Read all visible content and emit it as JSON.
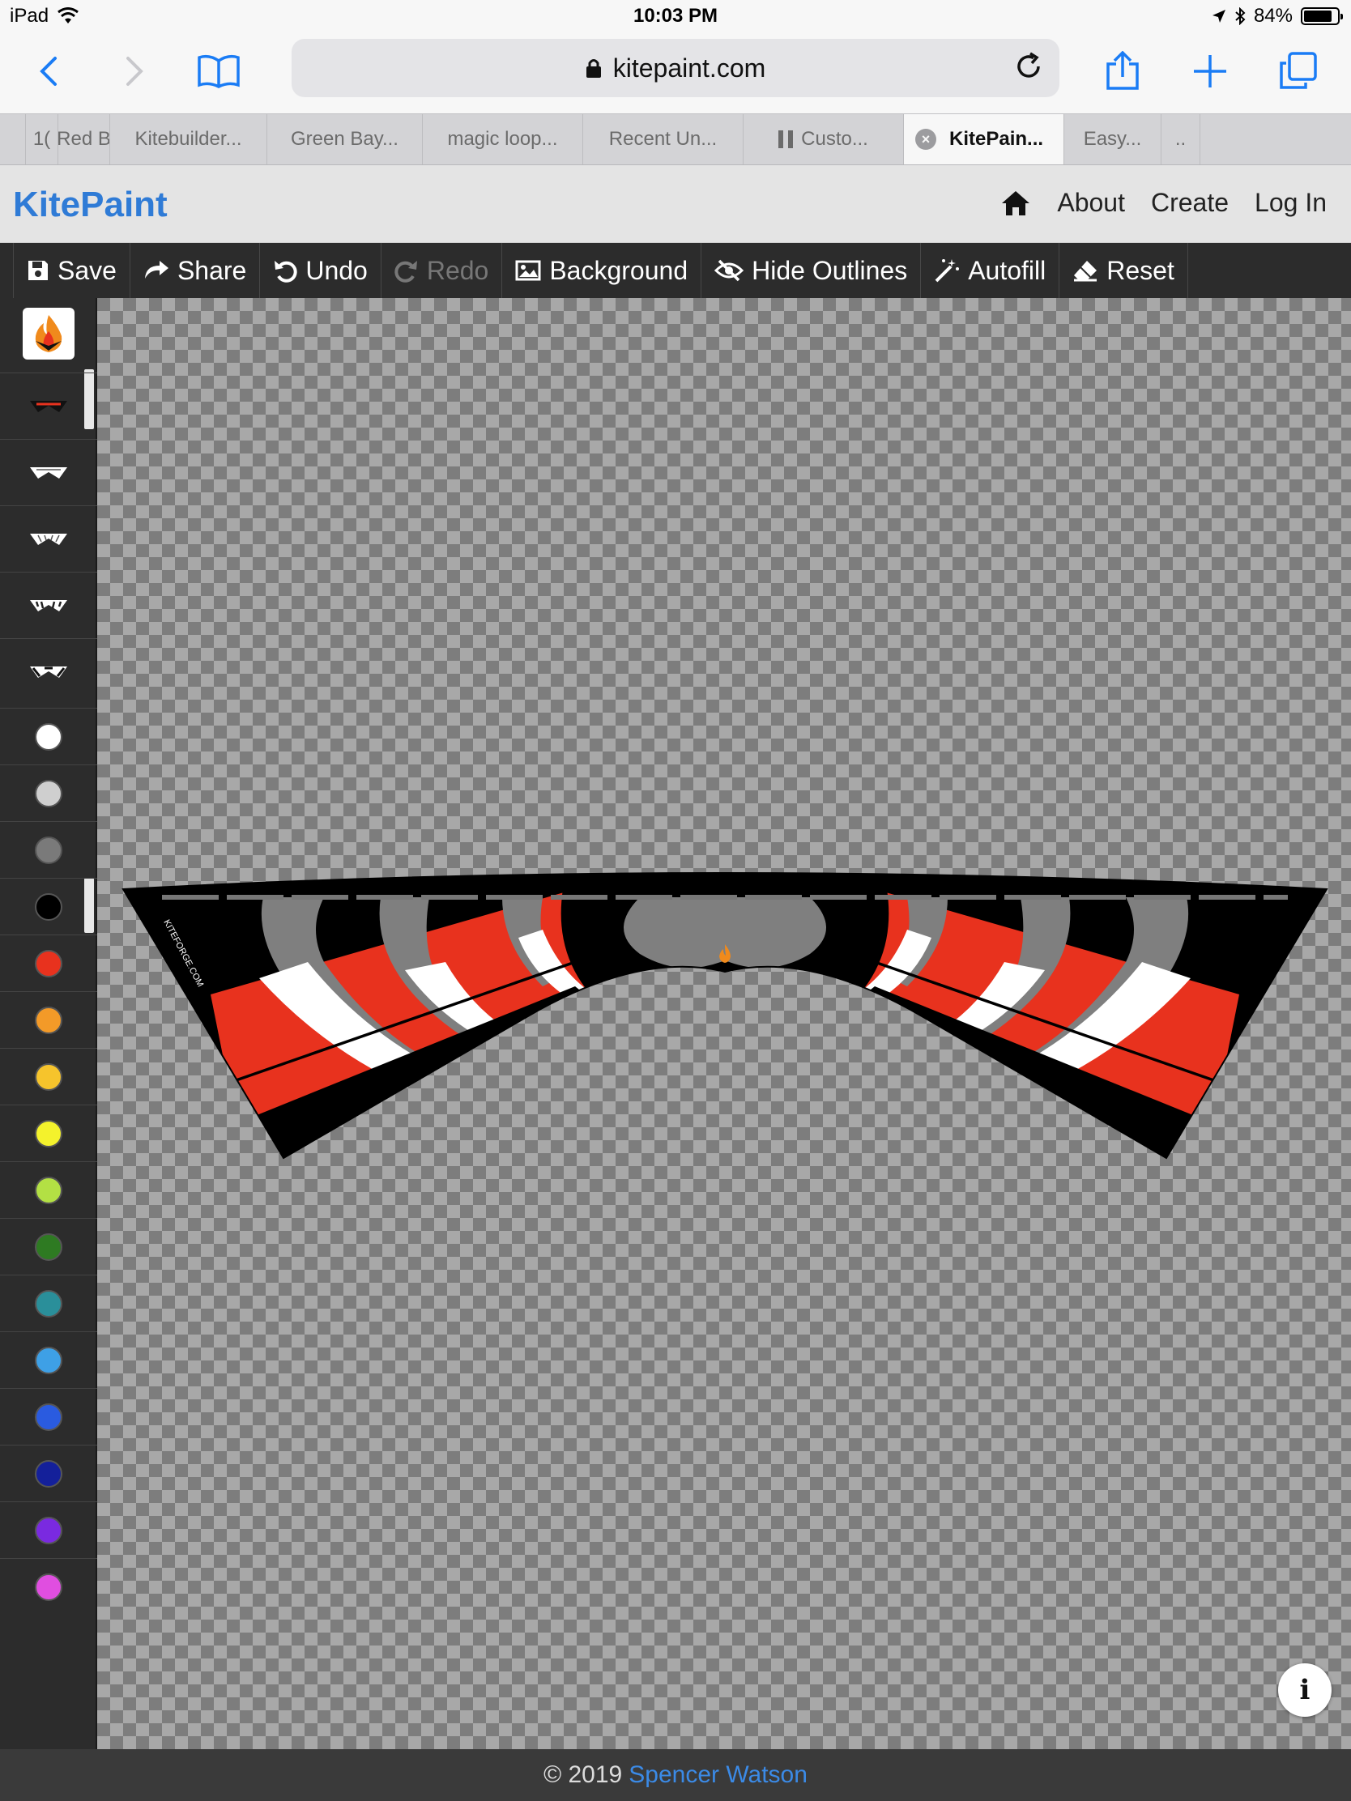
{
  "status": {
    "device": "iPad",
    "time": "10:03 PM",
    "battery": "84%",
    "battery_level": 0.84
  },
  "browser": {
    "url": "kitepaint.com",
    "tabs": [
      {
        "label": "1("
      },
      {
        "label": "Red B"
      },
      {
        "label": "Kitebuilder..."
      },
      {
        "label": "Green Bay..."
      },
      {
        "label": "magic loop..."
      },
      {
        "label": "Recent Un..."
      },
      {
        "label": "Custo..."
      },
      {
        "label": "KitePain..."
      },
      {
        "label": "Easy..."
      },
      {
        "label": ".."
      }
    ],
    "active_tab": 7
  },
  "nav": {
    "brand": "KitePaint",
    "about": "About",
    "create": "Create",
    "login": "Log In"
  },
  "editor_toolbar": {
    "save": "Save",
    "share": "Share",
    "undo": "Undo",
    "redo": "Redo",
    "background": "Background",
    "hide_outlines": "Hide Outlines",
    "autofill": "Autofill",
    "reset": "Reset"
  },
  "palette": {
    "colors": [
      "#ffffff",
      "#cfcfcf",
      "#7a7a7a",
      "#000000",
      "#e8321e",
      "#f39a28",
      "#f6c42c",
      "#f4f22c",
      "#b3e044",
      "#2e7a22",
      "#2a8f9a",
      "#3ea0e6",
      "#2a5be0",
      "#14209a",
      "#7a2ae0",
      "#e04ee0"
    ]
  },
  "kite": {
    "brand_text": "KITEFORGE.COM",
    "colors": {
      "black": "#000000",
      "gray": "#7f7f7f",
      "white": "#ffffff",
      "red": "#e8321e"
    }
  },
  "info_label": "i",
  "footer": {
    "copyright": "© 2019",
    "author": "Spencer Watson"
  }
}
